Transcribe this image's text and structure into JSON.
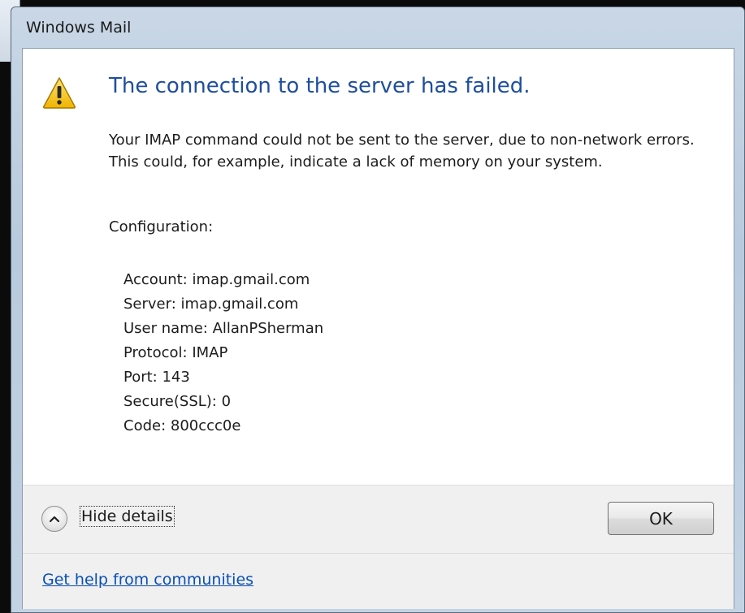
{
  "dialog": {
    "title": "Windows Mail",
    "main_instruction": "The connection to the server has failed.",
    "body": "Your IMAP command could not be sent to the server, due to non-network errors. This could, for example, indicate a lack of memory on your system.",
    "config_label": "Configuration:",
    "config": [
      "Account: imap.gmail.com",
      "Server: imap.gmail.com",
      "User name: AllanPSherman",
      "Protocol: IMAP",
      "Port: 143",
      "Secure(SSL): 0",
      "Code: 800ccc0e"
    ],
    "icon": "warning-icon"
  },
  "footer": {
    "toggle_label": "Hide details",
    "toggle_icon": "chevron-up-icon",
    "ok_label": "OK",
    "help_link": "Get help from communities"
  },
  "colors": {
    "instruction": "#1f4e9e",
    "link": "#0a4fb4",
    "warning_fill": "#f5c518"
  }
}
